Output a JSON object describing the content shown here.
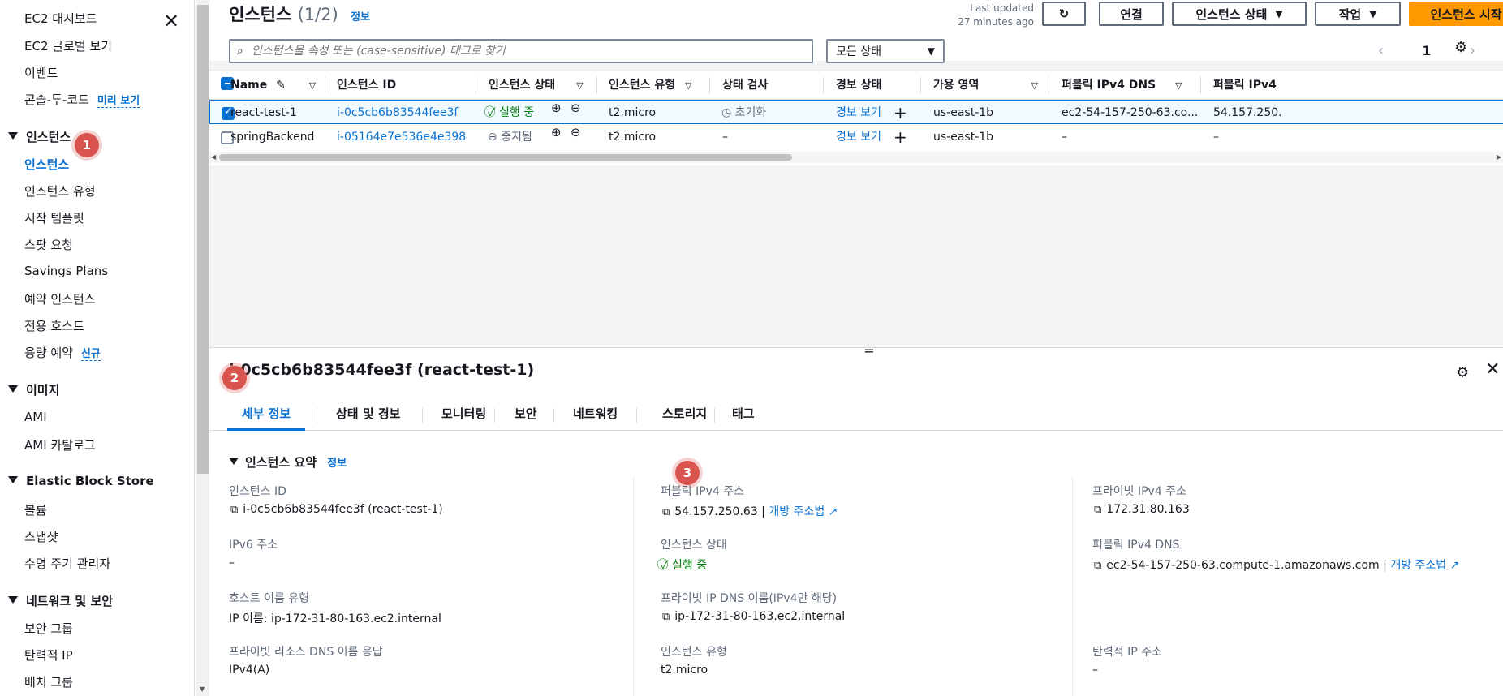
{
  "sidebar": {
    "top_links": [
      "EC2 대시보드",
      "EC2 글로벌 보기",
      "이벤트",
      "콘솔-투-코드"
    ],
    "preview_badge": "미리 보기",
    "sections": {
      "instances": {
        "title": "인스턴스",
        "items": [
          "인스턴스",
          "인스턴스 유형",
          "시작 템플릿",
          "스팟 요청",
          "Savings Plans",
          "예약 인스턴스",
          "전용 호스트",
          "용량 예약"
        ]
      },
      "images": {
        "title": "이미지",
        "items": [
          "AMI",
          "AMI 카탈로그"
        ]
      },
      "ebs": {
        "title": "Elastic Block Store",
        "items": [
          "볼륨",
          "스냅샷",
          "수명 주기 관리자"
        ]
      },
      "network": {
        "title": "네트워크 및 보안",
        "items": [
          "보안 그룹",
          "탄력적 IP",
          "배치 그룹"
        ]
      }
    },
    "new_badge": "신규"
  },
  "markers": [
    "1",
    "2",
    "3"
  ],
  "header": {
    "title": "인스턴스",
    "count": "(1/2)",
    "info": "정보",
    "last_updated_1": "Last updated",
    "last_updated_2": "27 minutes ago",
    "btn_connect": "연결",
    "btn_state": "인스턴스 상태",
    "btn_actions": "작업",
    "btn_launch": "인스턴스 시작",
    "search_placeholder": "인스턴스을 속성 또는 (case-sensitive) 태그로 찾기",
    "filter_state": "모든 상태",
    "page": "1"
  },
  "table": {
    "columns": [
      "Name",
      "인스턴스 ID",
      "인스턴스 상태",
      "인스턴스 유형",
      "상태 검사",
      "경보 상태",
      "가용 영역",
      "퍼블릭 IPv4 DNS",
      "퍼블릭 IPv4"
    ],
    "rows": [
      {
        "name": "react-test-1",
        "id": "i-0c5cb6b83544fee3f",
        "state": "실행 중",
        "type": "t2.micro",
        "check": "초기화",
        "alarm": "경보 보기",
        "az": "us-east-1b",
        "dns": "ec2-54-157-250-63.co...",
        "ip": "54.157.250.",
        "selected": true
      },
      {
        "name": "springBackend",
        "id": "i-05164e7e536e4e398",
        "state": "중지됨",
        "type": "t2.micro",
        "check": "–",
        "alarm": "경보 보기",
        "az": "us-east-1b",
        "dns": "–",
        "ip": "–",
        "selected": false
      }
    ]
  },
  "detail": {
    "title": "i-0c5cb6b83544fee3f (react-test-1)",
    "tabs": [
      "세부 정보",
      "상태 및 경보",
      "모니터링",
      "보안",
      "네트워킹",
      "스토리지",
      "태그"
    ],
    "summary_title": "인스턴스 요약",
    "summary_info": "정보",
    "fields": {
      "instance_id_label": "인스턴스 ID",
      "instance_id_value": "i-0c5cb6b83544fee3f (react-test-1)",
      "ipv6_label": "IPv6 주소",
      "ipv6_value": "–",
      "hostname_type_label": "호스트 이름 유형",
      "hostname_type_value": "IP 이름: ip-172-31-80-163.ec2.internal",
      "private_dns_resp_label": "프라이빗 리소스 DNS 이름 응답",
      "private_dns_resp_value": "IPv4(A)",
      "public_ipv4_label": "퍼블릭 IPv4 주소",
      "public_ipv4_value": "54.157.250.63",
      "open_address": "개방 주소법",
      "instance_state_label": "인스턴스 상태",
      "instance_state_value": "실행 중",
      "private_ip_dns_label": "프라이빗 IP DNS 이름(IPv4만 해당)",
      "private_ip_dns_value": "ip-172-31-80-163.ec2.internal",
      "instance_type_label": "인스턴스 유형",
      "instance_type_value": "t2.micro",
      "private_ipv4_label": "프라이빗 IPv4 주소",
      "private_ipv4_value": "172.31.80.163",
      "public_dns_label": "퍼블릭 IPv4 DNS",
      "public_dns_value": "ec2-54-157-250-63.compute-1.amazonaws.com",
      "elastic_ip_label": "탄력적 IP 주소",
      "elastic_ip_value": "–"
    }
  },
  "colors": {
    "accent": "#0972d3",
    "primary_button": "#ff9900",
    "running": "#037f0c",
    "marker": "#d9534f"
  }
}
